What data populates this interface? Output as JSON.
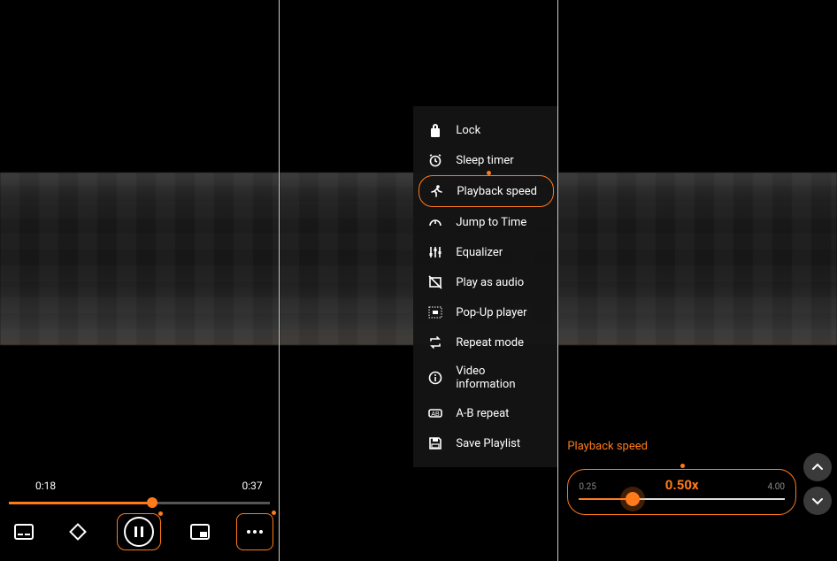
{
  "accent": "#ff7a1a",
  "panel1": {
    "current_time": "0:18",
    "total_time": "0:37",
    "progress_pct": 55
  },
  "menu": {
    "items": [
      {
        "icon": "lock-icon",
        "label": "Lock"
      },
      {
        "icon": "alarm-icon",
        "label": "Sleep timer"
      },
      {
        "icon": "run-icon",
        "label": "Playback speed",
        "highlighted": true
      },
      {
        "icon": "jump-icon",
        "label": "Jump to Time"
      },
      {
        "icon": "equalizer-icon",
        "label": "Equalizer"
      },
      {
        "icon": "audio-only-icon",
        "label": "Play as audio"
      },
      {
        "icon": "popup-icon",
        "label": "Pop-Up player"
      },
      {
        "icon": "repeat-icon",
        "label": "Repeat mode"
      },
      {
        "icon": "info-icon",
        "label": "Video information"
      },
      {
        "icon": "ab-repeat-icon",
        "label": "A-B repeat"
      },
      {
        "icon": "save-icon",
        "label": "Save Playlist"
      }
    ]
  },
  "speed": {
    "title": "Playback speed",
    "min": "0.25",
    "max": "4.00",
    "value": "0.50x",
    "fill_pct": 26
  }
}
